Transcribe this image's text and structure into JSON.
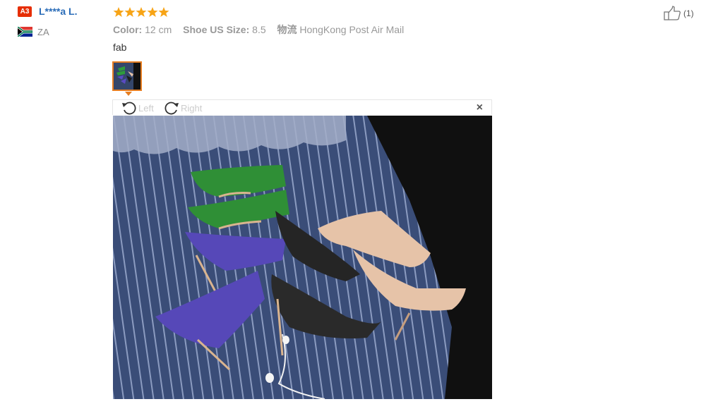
{
  "reviewer": {
    "level_badge": "A3",
    "name": "L****a L.",
    "country": "ZA",
    "flag_icon": "south-africa-flag"
  },
  "review": {
    "rating": 5,
    "meta": [
      {
        "label": "Color:",
        "value": "12 cm"
      },
      {
        "label": "Shoe US Size:",
        "value": "8.5"
      },
      {
        "label": "物流",
        "value": "HongKong Post Air Mail"
      }
    ],
    "text": "fab",
    "helpful_count": "(1)"
  },
  "viewer": {
    "rotate_left_label": "Left",
    "rotate_right_label": "Right",
    "close_label": "×"
  },
  "colors": {
    "star": "#f7a416",
    "name": "#2a6cb8",
    "badge": "#e62e04",
    "thumb_border": "#e67e22"
  }
}
